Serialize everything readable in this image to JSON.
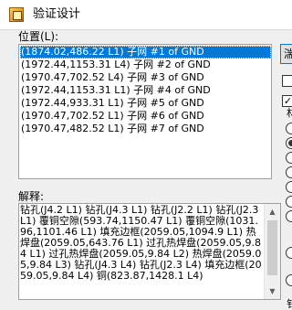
{
  "window": {
    "title": "验证设计"
  },
  "location": {
    "label": "位置(L):",
    "items": [
      "(1874.02,486.22 L1) 子网 #1 of GND",
      "(1972.44,1153.31 L4) 子网 #2 of GND",
      "(1970.47,702.52 L4) 子网 #3 of GND",
      "(1972.44,1153.31 L1) 子网 #4 of GND",
      "(1972.44,933.31 L1) 子网 #5 of GND",
      "(1970.47,702.52 L1) 子网 #6 of GND",
      "(1970.47,482.52 L1) 子网 #7 of GND"
    ],
    "selected_index": 0
  },
  "explanation": {
    "label": "解释:",
    "text": "钻孔(J4.2 L1) 钻孔(J4.3 L1) 钻孔(J2.2 L1) 钻孔(J2.3 L1) 覆铜空隙(593.74,1150.47 L1) 覆铜空隙(1031.96,1101.46 L1) 填充边框(2059.05,1094.9 L1) 热焊盘(2059.05,643.76 L1) 过孔热焊盘(2059.05,9.84 L1) 过孔热焊盘(2059.05,9.84 L2) 热焊盘(2059.05,9.84 L3) 钻孔(J4.3 L4) 钻孔(J2.3 L4) 填充边框(2059.05,9.84 L4) 铜(823.87,1428.1 L4)"
  },
  "right_panel": {
    "button_fragment": "湍",
    "frag_1": "材",
    "frag_2": "钅"
  },
  "scroll": {
    "up_icon": "▲",
    "down_icon": "▼"
  }
}
